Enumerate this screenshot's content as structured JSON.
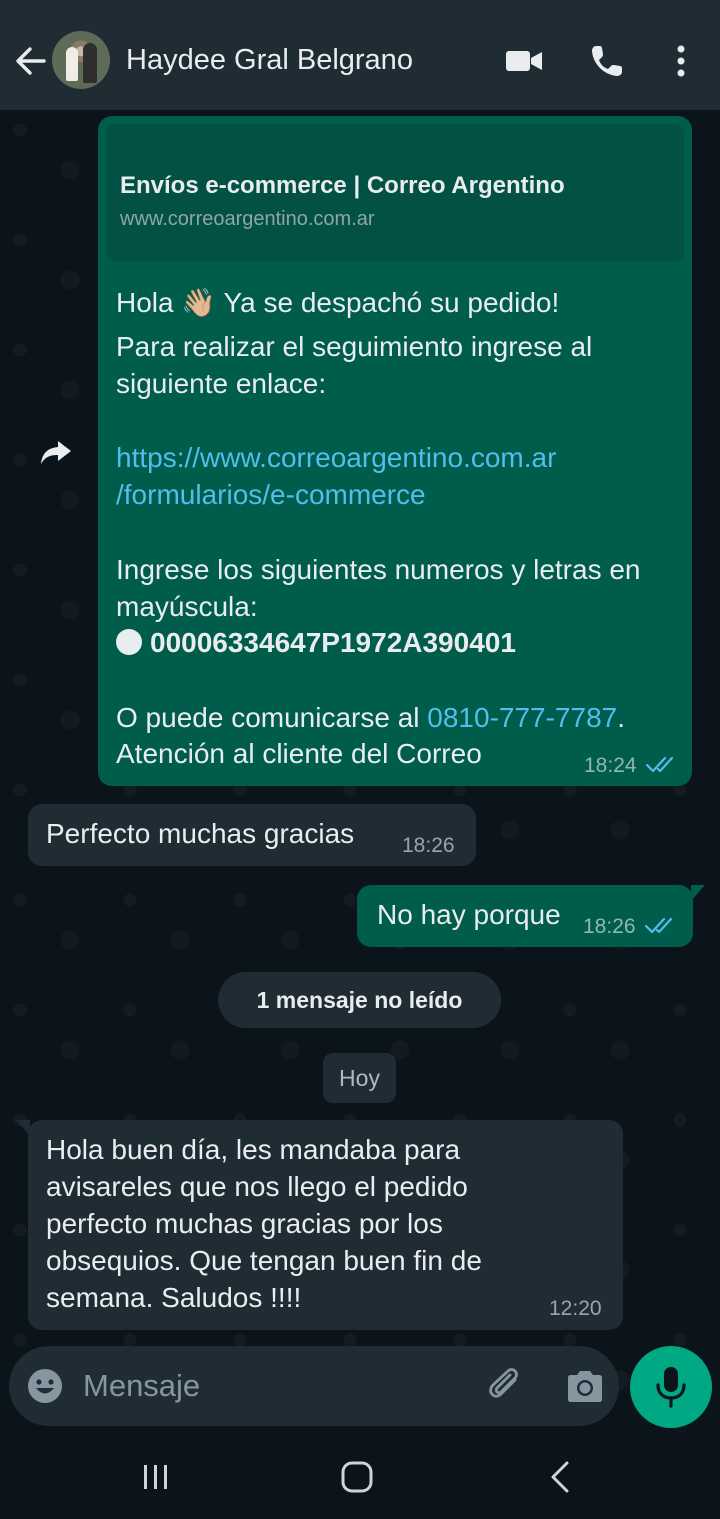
{
  "header": {
    "contact_name": "Haydee Gral Belgrano"
  },
  "messages": [
    {
      "direction": "outgoing",
      "forwarded": true,
      "link_preview": {
        "title": "Envíos e-commerce | Correo Argentino",
        "url": "www.correoargentino.com.ar"
      },
      "greeting_before_emoji": "Hola ",
      "emoji": "👋🏼",
      "greeting_after_emoji": " Ya se despachó su pedido!",
      "line2": "Para realizar el seguimiento ingrese al",
      "line3": "siguiente enlace:",
      "link_line1": "https://www.correoargentino.com.ar",
      "link_line2": "/formularios/e-commerce",
      "line4": "Ingrese los siguientes numeros y letras en",
      "line5": "mayúscula:",
      "code": "00006334647P1972A390401",
      "contact_before": "O puede comunicarse al ",
      "phone": "0810-777-7787",
      "contact_after": ".",
      "line7": "Atención al cliente del Correo",
      "time": "18:24",
      "status": "read"
    },
    {
      "direction": "incoming",
      "text": "Perfecto muchas gracias",
      "time": "18:26"
    },
    {
      "direction": "outgoing",
      "text": "No hay porque",
      "time": "18:26",
      "status": "read"
    },
    {
      "direction": "incoming",
      "lines": [
        "Hola buen día, les mandaba para",
        "avisareles que nos llego el pedido",
        "perfecto muchas gracias por los",
        "obsequios. Que tengan buen fin de",
        "semana.  Saludos !!!!"
      ],
      "time": "12:20"
    }
  ],
  "unread_banner": "1 mensaje no leído",
  "date_divider": "Hoy",
  "composer": {
    "placeholder": "Mensaje"
  },
  "icons": {
    "back": "arrow-left-icon",
    "video": "video-camera-icon",
    "phone": "phone-icon",
    "menu": "kebab-menu-icon",
    "forward": "forward-arrow-icon",
    "emoji": "smiley-icon",
    "attach": "paperclip-icon",
    "camera": "camera-icon",
    "mic": "microphone-icon"
  },
  "colors": {
    "background": "#0b141a",
    "header": "#1f2c34",
    "outgoing_bubble": "#005c4b",
    "incoming_bubble": "#1f2c34",
    "link": "#53bdeb",
    "read_ticks": "#53bdeb",
    "accent": "#00a884"
  }
}
